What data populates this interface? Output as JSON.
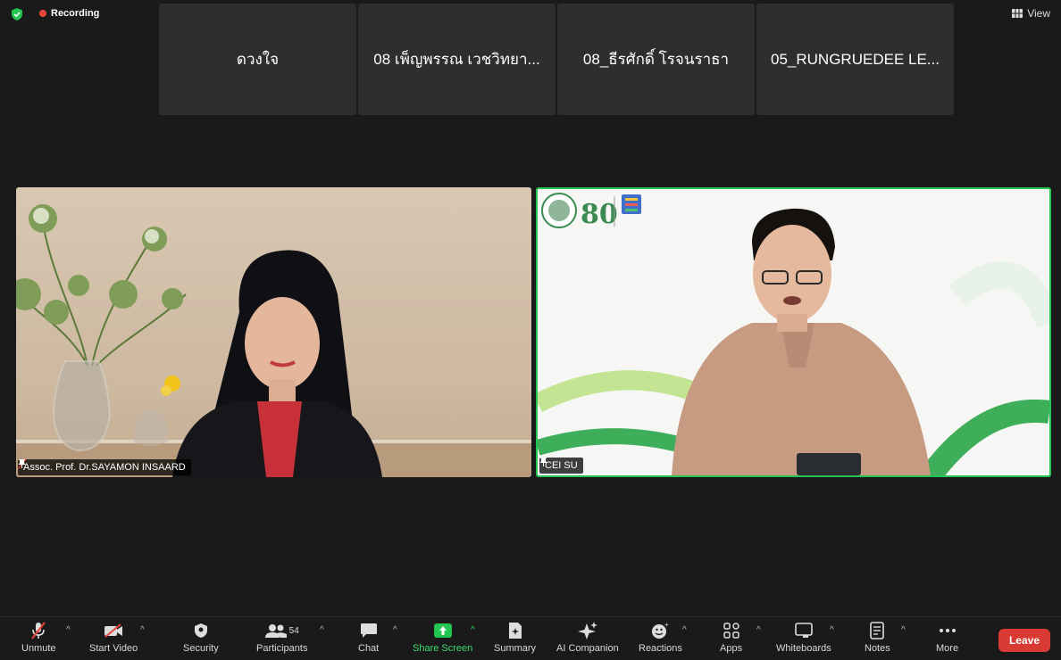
{
  "top": {
    "recording_label": "Recording",
    "view_label": "View"
  },
  "thumbnails": [
    "ดวงใจ",
    "08 เพ็ญพรรณ เวชวิทยา...",
    "08_ธีรศักดิ์ โรจนราธา",
    "05_RUNGRUEDEE LE..."
  ],
  "tiles": {
    "left_name": "Assoc. Prof. Dr.SAYAMON INSAARD",
    "right_name": "CEI SU"
  },
  "toolbar": {
    "unmute": "Unmute",
    "start_video": "Start Video",
    "security": "Security",
    "participants": "Participants",
    "participant_count": "54",
    "chat": "Chat",
    "share_screen": "Share Screen",
    "summary": "Summary",
    "ai_companion": "AI Companion",
    "reactions": "Reactions",
    "apps": "Apps",
    "whiteboards": "Whiteboards",
    "notes": "Notes",
    "more": "More",
    "leave": "Leave"
  },
  "colors": {
    "active_speaker_border": "#23c552",
    "recording_dot": "#e8443a",
    "share_green": "#23c552",
    "leave_red": "#d93a34"
  }
}
